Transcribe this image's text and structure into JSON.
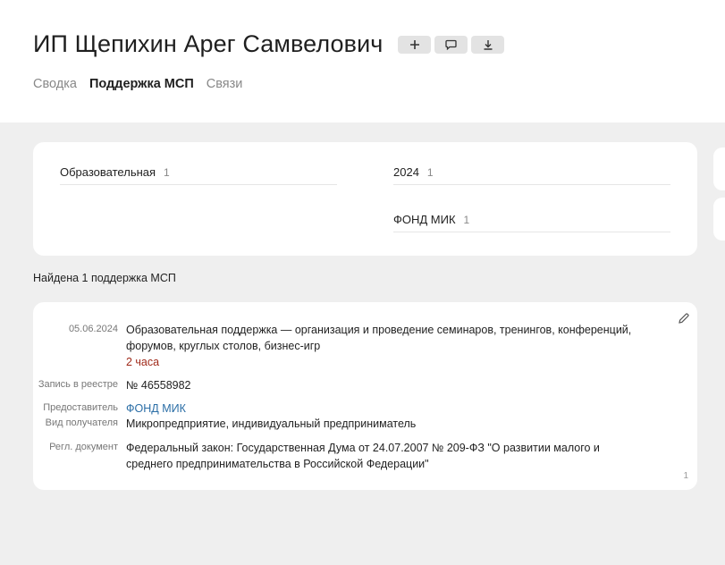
{
  "header": {
    "title": "ИП Щепихин Арег Самвелович",
    "buttons": [
      {
        "icon": "plus-icon"
      },
      {
        "icon": "comment-icon"
      },
      {
        "icon": "download-icon"
      }
    ]
  },
  "tabs": [
    {
      "label": "Сводка",
      "active": false
    },
    {
      "label": "Поддержка МСП",
      "active": true
    },
    {
      "label": "Связи",
      "active": false
    }
  ],
  "filters": [
    {
      "label": "Образовательная",
      "count": "1"
    },
    {
      "label": "2024",
      "count": "1"
    },
    {
      "label": "ФОНД МИК",
      "count": "1"
    }
  ],
  "found_text": "Найдена 1 поддержка МСП",
  "result": {
    "date": "05.06.2024",
    "description": "Образовательная поддержка — организация и проведение семинаров, тренингов, конференций, форумов, круглых столов, бизнес-игр",
    "duration": "2 часа",
    "registry_label": "Запись в реестре",
    "registry_value": "№ 46558982",
    "provider_label": "Предоставитель",
    "provider_value": "ФОНД МИК",
    "recipient_label": "Вид получателя",
    "recipient_value": "Микропредприятие, индивидуальный предприниматель",
    "doc_label": "Регл. документ",
    "doc_value": "Федеральный закон: Государственная Дума от 24.07.2007 № 209-ФЗ \"О развитии малого и среднего предпринимательства в Российской Федерации\"",
    "page": "1"
  },
  "colors": {
    "link": "#2b6ea6",
    "duration": "#a02a1a",
    "background": "#efefef"
  }
}
